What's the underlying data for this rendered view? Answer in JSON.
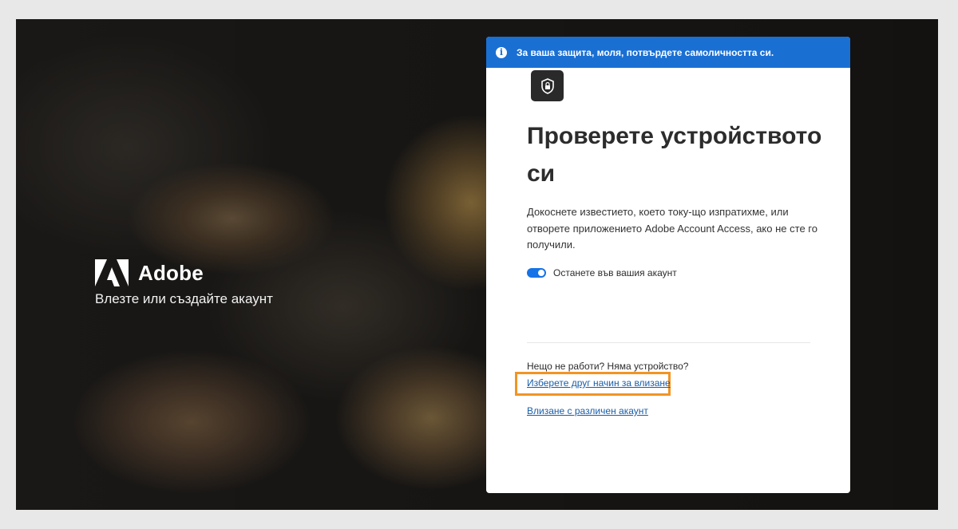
{
  "brand": {
    "name": "Adobe",
    "tagline": "Влезте или създайте акаунт"
  },
  "banner": {
    "icon": "info-icon",
    "text": "За ваша защита, моля, потвърдете самоличността си."
  },
  "card": {
    "app_icon": "shield-lock-icon",
    "title": "Проверете устройството си",
    "description": "Докоснете известието, което току-що изпратихме, или отворете приложението Adobe Account Access, ако не сте го получили.",
    "stay_signed_in": {
      "label": "Останете във вашия акаунт",
      "checked": true
    },
    "help_text": "Нещо не работи? Няма устройство?",
    "alt_signin_link": "Изберете друг начин за влизане",
    "other_account_link": "Влизане с различен акаунт"
  },
  "colors": {
    "banner_bg": "#1a6fd3",
    "link": "#1a5ea8",
    "highlight": "#f29423",
    "toggle": "#1473e6"
  }
}
